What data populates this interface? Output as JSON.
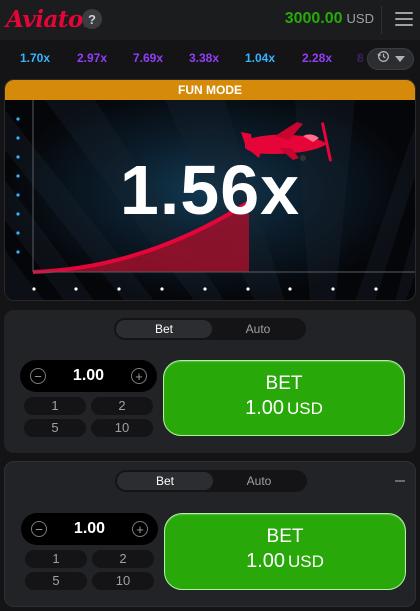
{
  "header": {
    "logo": "Aviator",
    "help_label": "?",
    "balance": "3000.00",
    "currency": "USD"
  },
  "history": {
    "multipliers": [
      {
        "value": "1.70x",
        "color": "#34b4ff"
      },
      {
        "value": "2.97x",
        "color": "#913ef8"
      },
      {
        "value": "7.69x",
        "color": "#913ef8"
      },
      {
        "value": "3.38x",
        "color": "#913ef8"
      },
      {
        "value": "1.04x",
        "color": "#34b4ff"
      },
      {
        "value": "2.28x",
        "color": "#913ef8"
      },
      {
        "value": "8",
        "color": "#913ef8"
      }
    ],
    "button_icons": [
      "history-icon",
      "chevron-down-icon"
    ]
  },
  "game": {
    "banner": "FUN MODE",
    "multiplier": "1.56x",
    "accent": "#e50539"
  },
  "bet_panels": [
    {
      "tabs": [
        "Bet",
        "Auto"
      ],
      "active_tab": "Bet",
      "amount": "1.00",
      "quick_amounts": [
        "1",
        "2",
        "5",
        "10"
      ],
      "button_line1": "BET",
      "button_amount": "1.00",
      "button_currency": "USD"
    },
    {
      "tabs": [
        "Bet",
        "Auto"
      ],
      "active_tab": "Bet",
      "amount": "1.00",
      "quick_amounts": [
        "1",
        "2",
        "5",
        "10"
      ],
      "button_line1": "BET",
      "button_amount": "1.00",
      "button_currency": "USD"
    }
  ],
  "colors": {
    "balance_green": "#28a909",
    "bet_green": "#28a909",
    "fun_mode_orange": "#d68a0a"
  }
}
